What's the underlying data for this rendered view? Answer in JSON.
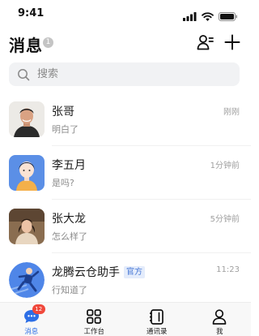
{
  "status_bar": {
    "time": "9:41",
    "icons": [
      "signal-icon",
      "wifi-icon",
      "battery-icon"
    ]
  },
  "header": {
    "title": "消息",
    "badge": "1",
    "actions": [
      "contacts-icon",
      "plus-icon"
    ]
  },
  "search": {
    "placeholder": "搜索",
    "value": ""
  },
  "chats": [
    {
      "name": "张哥",
      "preview": "明白了",
      "time": "刚刚",
      "tag": ""
    },
    {
      "name": "李五月",
      "preview": "是吗?",
      "time": "1分钟前",
      "tag": ""
    },
    {
      "name": "张大龙",
      "preview": "怎么样了",
      "time": "5分钟前",
      "tag": ""
    },
    {
      "name": "龙腾云仓助手",
      "preview": "行知道了",
      "time": "11:23",
      "tag": "官方"
    }
  ],
  "tab_bar": {
    "items": [
      {
        "label": "消息",
        "icon": "chat-bubble-icon",
        "badge": "12",
        "active": true
      },
      {
        "label": "工作台",
        "icon": "grid-icon",
        "badge": "",
        "active": false
      },
      {
        "label": "通讯录",
        "icon": "address-book-icon",
        "badge": "",
        "active": false
      },
      {
        "label": "我",
        "icon": "person-icon",
        "badge": "",
        "active": false
      }
    ]
  },
  "colors": {
    "accent": "#2d6fe6",
    "badge_red": "#f0483b",
    "search_bg": "#f1f2f4",
    "official_tag_bg": "#e4ecfb"
  }
}
